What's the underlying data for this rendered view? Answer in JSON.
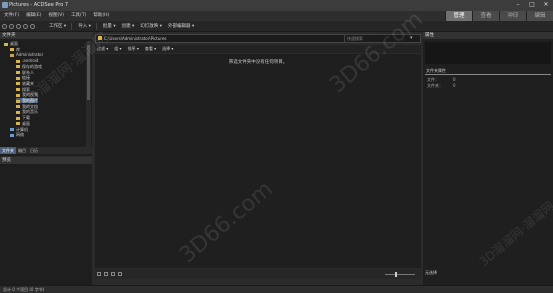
{
  "window": {
    "title": "Pictures - ACDSee Pro 7"
  },
  "menu": [
    "文件(F)",
    "编辑(E)",
    "视图(V)",
    "工具(T)",
    "帮助(H)"
  ],
  "modes": [
    {
      "label": "管理",
      "active": true
    },
    {
      "label": "查看",
      "active": false
    },
    {
      "label": "冲印",
      "active": false
    },
    {
      "label": "编辑",
      "active": false
    }
  ],
  "toolbar": {
    "workspace": "工作区 ▾",
    "import": "导入 ▾",
    "batch": "批量 ▾",
    "create": "创建 ▾",
    "slideshow": "幻灯放映 ▾",
    "external_editor": "外部编辑器 ▾"
  },
  "folders_panel": {
    "title": "文件夹",
    "tree": [
      {
        "label": "桌面",
        "level": 0,
        "icon": "folder"
      },
      {
        "label": "库",
        "level": 1,
        "icon": "folder"
      },
      {
        "label": "Administrator",
        "level": 1,
        "icon": "user"
      },
      {
        "label": ".android",
        "level": 2,
        "icon": "folder"
      },
      {
        "label": "保存的游戏",
        "level": 2,
        "icon": "folder"
      },
      {
        "label": "联系人",
        "level": 2,
        "icon": "folder"
      },
      {
        "label": "链接",
        "level": 2,
        "icon": "folder"
      },
      {
        "label": "收藏夹",
        "level": 2,
        "icon": "folder"
      },
      {
        "label": "搜索",
        "level": 2,
        "icon": "folder"
      },
      {
        "label": "我的视频",
        "level": 2,
        "icon": "folder"
      },
      {
        "label": "我的图片",
        "level": 2,
        "icon": "folder",
        "selected": true
      },
      {
        "label": "我的文档",
        "level": 2,
        "icon": "folder"
      },
      {
        "label": "我的音乐",
        "level": 2,
        "icon": "folder"
      },
      {
        "label": "下载",
        "level": 2,
        "icon": "folder"
      },
      {
        "label": "桌面",
        "level": 2,
        "icon": "folder"
      },
      {
        "label": "计算机",
        "level": 1,
        "icon": "pc"
      },
      {
        "label": "网络",
        "level": 1,
        "icon": "pc"
      }
    ],
    "tabs": [
      "文件夹",
      "编目",
      "日历"
    ]
  },
  "preview_panel": {
    "title": "预览"
  },
  "path": "C:\\Users\\Administrator\\Pictures",
  "search_placeholder": "快速搜索",
  "sort_bar": [
    "过滤 ▾",
    "组 ▾",
    "排序 ▾",
    "查看 ▾",
    "选择 ▾"
  ],
  "content": {
    "empty_message": "筛选文件夹中没有任何项目。"
  },
  "properties_panel": {
    "title": "属性",
    "section": "文件夹属性",
    "fields": [
      {
        "label": "文件：",
        "value": "0"
      },
      {
        "label": "文件夹：",
        "value": "0"
      }
    ]
  },
  "bottom_bar": {
    "select_label": "无选择"
  },
  "statusbar": {
    "text": "总计 0 个项目 (0 字节)"
  },
  "watermark": [
    "3D66.com",
    "3D溜溜网·溜溜网"
  ]
}
